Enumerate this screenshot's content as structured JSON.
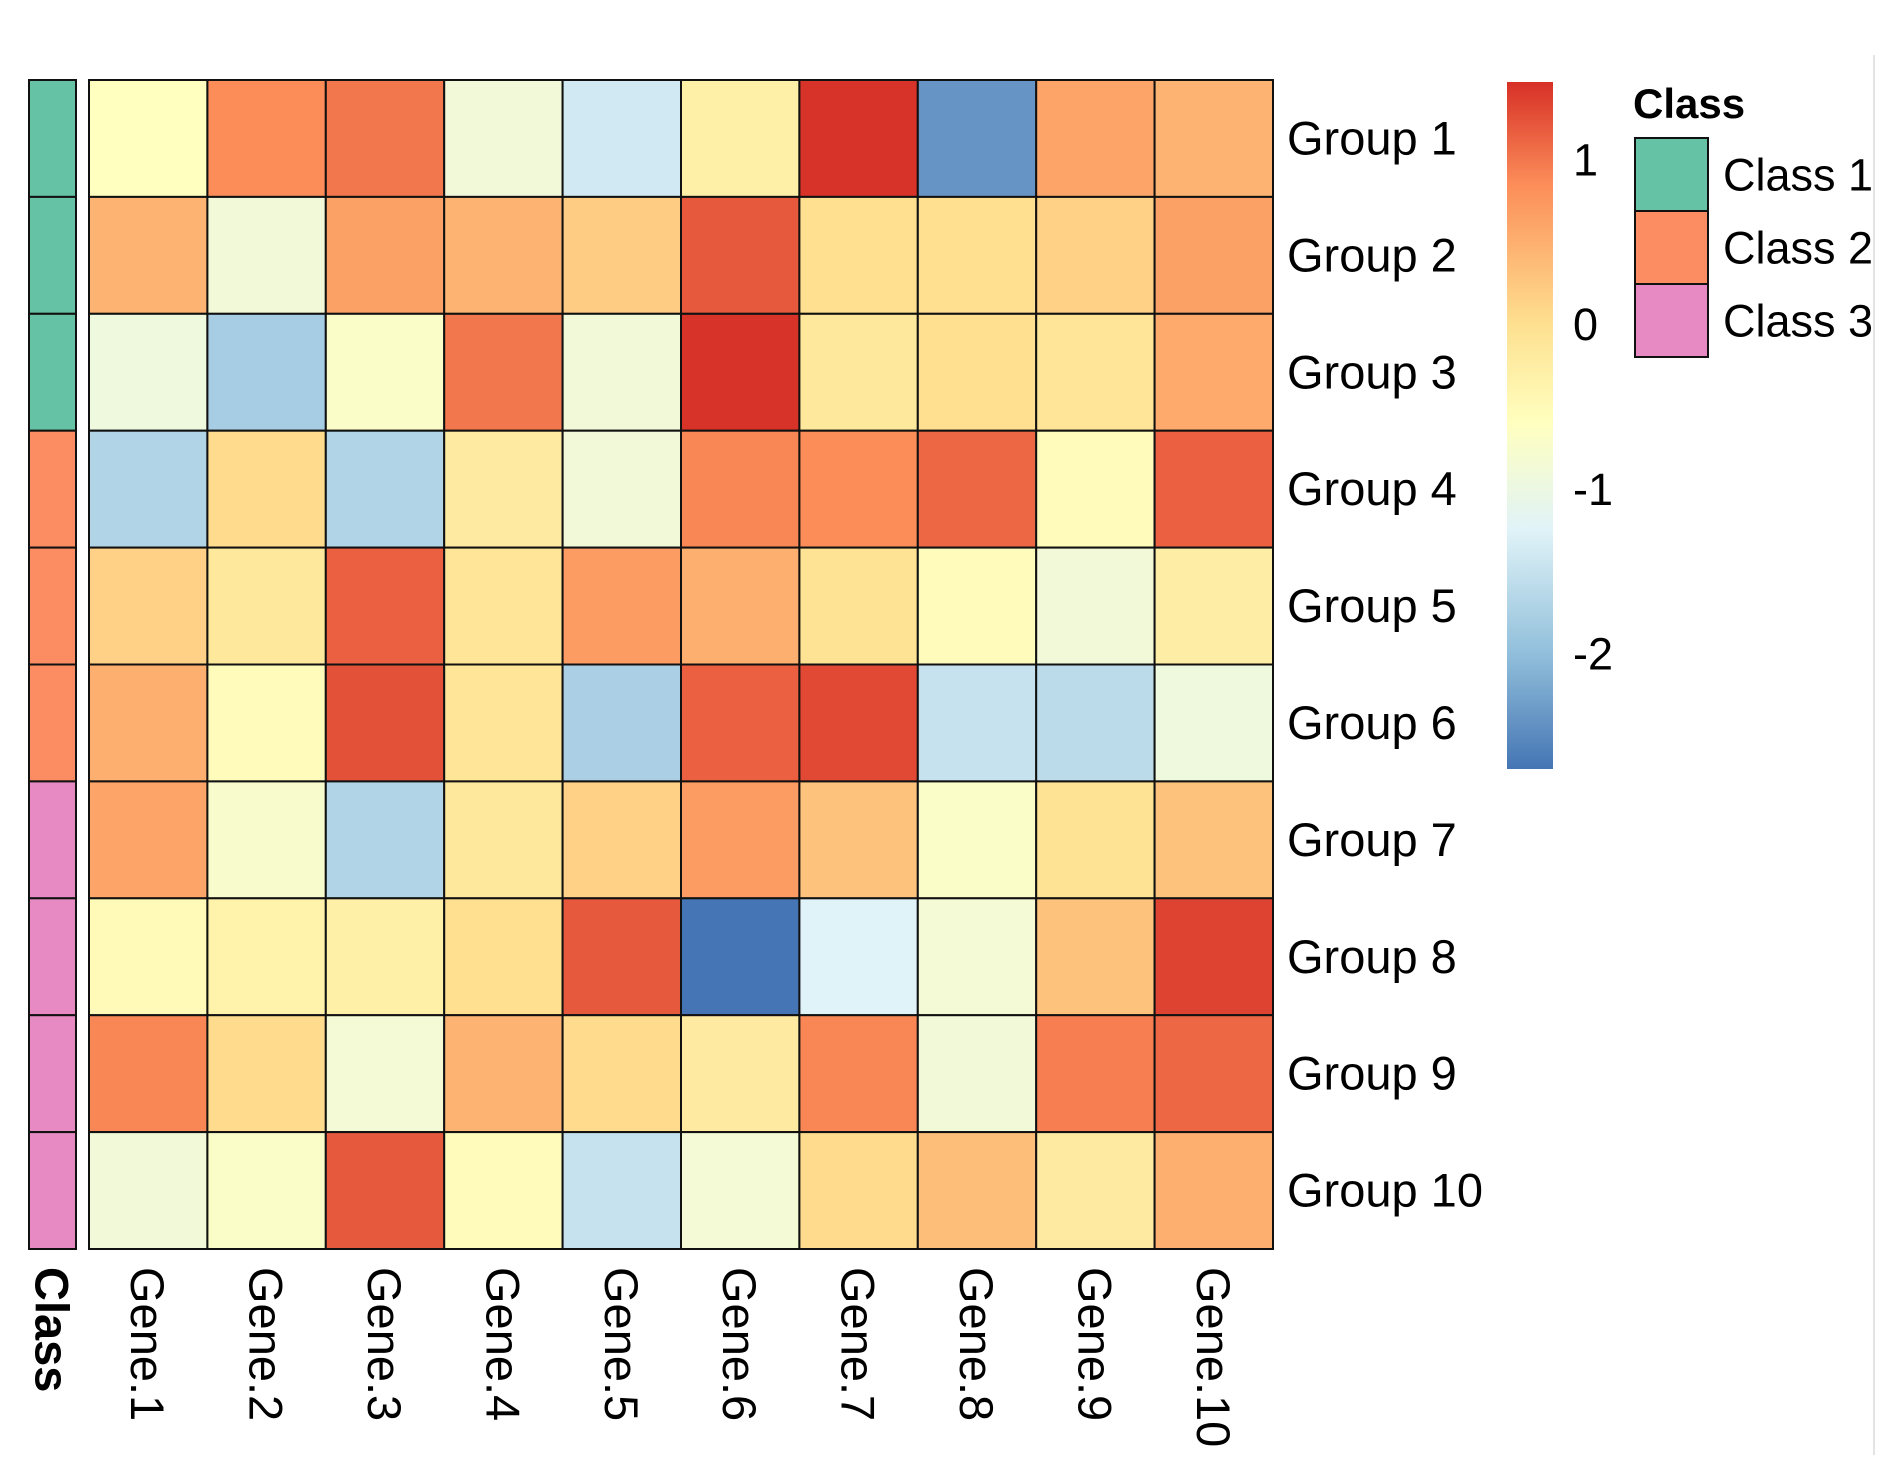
{
  "chart_data": {
    "type": "heatmap",
    "title": "",
    "rows": [
      "Group 1",
      "Group 2",
      "Group 3",
      "Group 4",
      "Group 5",
      "Group 6",
      "Group 7",
      "Group 8",
      "Group 9",
      "Group 10"
    ],
    "columns": [
      "Gene.1",
      "Gene.2",
      "Gene.3",
      "Gene.4",
      "Gene.5",
      "Gene.6",
      "Gene.7",
      "Gene.8",
      "Gene.9",
      "Gene.10"
    ],
    "values": [
      [
        -0.6,
        0.85,
        1.0,
        -0.9,
        -1.4,
        -0.3,
        1.45,
        -2.4,
        0.6,
        0.45
      ],
      [
        0.45,
        -0.9,
        0.65,
        0.45,
        0.2,
        1.2,
        0.0,
        0.0,
        0.15,
        0.65
      ],
      [
        -0.95,
        -1.8,
        -0.7,
        1.0,
        -0.9,
        1.45,
        -0.15,
        0.0,
        -0.1,
        0.55
      ],
      [
        -1.7,
        0.05,
        -1.7,
        -0.2,
        -0.9,
        0.9,
        0.85,
        1.1,
        -0.55,
        1.15
      ],
      [
        0.15,
        -0.15,
        1.15,
        -0.1,
        0.7,
        0.5,
        -0.05,
        -0.55,
        -0.9,
        -0.25
      ],
      [
        0.5,
        -0.55,
        1.25,
        -0.1,
        -1.75,
        1.15,
        1.3,
        -1.5,
        -1.6,
        -0.95
      ],
      [
        0.6,
        -0.75,
        -1.7,
        -0.15,
        0.15,
        0.7,
        0.3,
        -0.7,
        -0.05,
        0.3
      ],
      [
        -0.5,
        -0.35,
        -0.3,
        0.0,
        1.2,
        -2.7,
        -1.25,
        -0.85,
        0.3,
        1.35
      ],
      [
        0.9,
        0.05,
        -0.85,
        0.45,
        0.05,
        -0.2,
        0.9,
        -0.9,
        0.95,
        1.1
      ],
      [
        -0.9,
        -0.7,
        1.2,
        -0.55,
        -1.5,
        -0.85,
        0.05,
        0.35,
        -0.2,
        0.5
      ]
    ],
    "row_annotation": {
      "label": "Class",
      "values": [
        "Class 1",
        "Class 1",
        "Class 1",
        "Class 2",
        "Class 2",
        "Class 2",
        "Class 3",
        "Class 3",
        "Class 3",
        "Class 3"
      ]
    },
    "colorbar": {
      "ticks": [
        1,
        0,
        -1,
        -2
      ],
      "tick_labels": [
        "1",
        "0",
        "-1",
        "-2"
      ],
      "range": [
        -2.7,
        1.47
      ],
      "palette": [
        "#4575B4",
        "#91BFDB",
        "#E0F3F8",
        "#FFFFBF",
        "#FEE090",
        "#FC8D59",
        "#D73027"
      ],
      "palette_stops": [
        -2.7,
        -2.0,
        -1.25,
        -0.6,
        0.0,
        0.85,
        1.47
      ]
    },
    "legend": {
      "title": "Class",
      "placement": "top-right",
      "items": [
        {
          "label": "Class 1",
          "color": "#66C2A5"
        },
        {
          "label": "Class 2",
          "color": "#FC8D62"
        },
        {
          "label": "Class 3",
          "color": "#E78AC3"
        }
      ]
    },
    "xlabel": "",
    "ylabel": "",
    "grid": false
  }
}
